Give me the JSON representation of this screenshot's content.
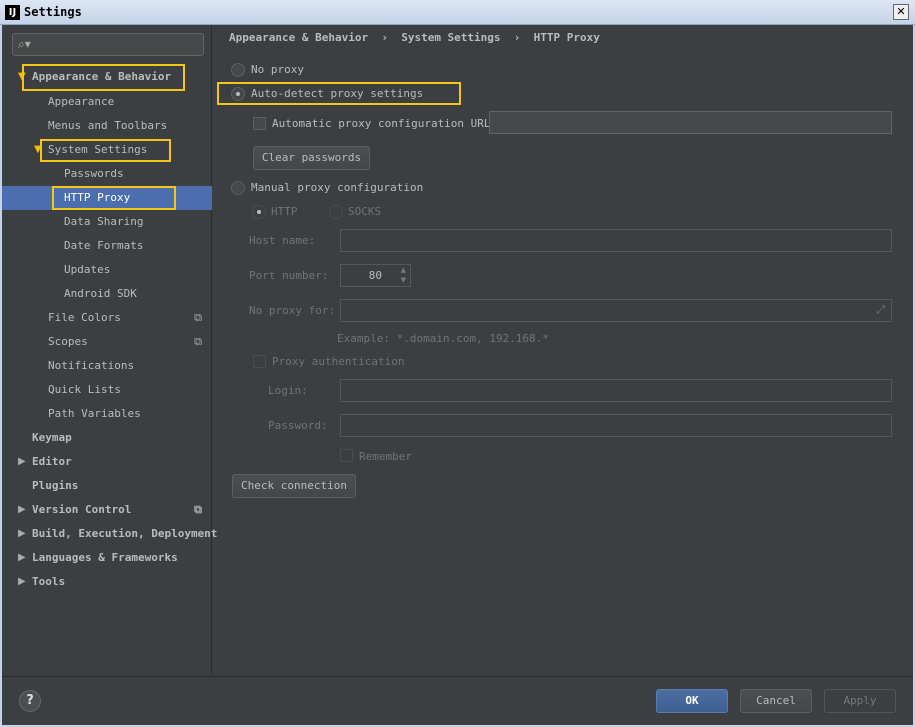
{
  "window": {
    "title": "Settings",
    "app_icon": "IJ",
    "close": "✕"
  },
  "sidebar": {
    "search_placeholder": "",
    "items": [
      {
        "label": "Appearance & Behavior"
      },
      {
        "label": "Appearance"
      },
      {
        "label": "Menus and Toolbars"
      },
      {
        "label": "System Settings"
      },
      {
        "label": "Passwords"
      },
      {
        "label": "HTTP Proxy"
      },
      {
        "label": "Data Sharing"
      },
      {
        "label": "Date Formats"
      },
      {
        "label": "Updates"
      },
      {
        "label": "Android SDK"
      },
      {
        "label": "File Colors"
      },
      {
        "label": "Scopes"
      },
      {
        "label": "Notifications"
      },
      {
        "label": "Quick Lists"
      },
      {
        "label": "Path Variables"
      },
      {
        "label": "Keymap"
      },
      {
        "label": "Editor"
      },
      {
        "label": "Plugins"
      },
      {
        "label": "Version Control"
      },
      {
        "label": "Build, Execution, Deployment"
      },
      {
        "label": "Languages & Frameworks"
      },
      {
        "label": "Tools"
      }
    ]
  },
  "breadcrumb": {
    "part1": "Appearance & Behavior",
    "sep": "›",
    "part2": "System Settings",
    "part3": "HTTP Proxy"
  },
  "proxy": {
    "no_proxy": "No proxy",
    "auto_detect": "Auto-detect proxy settings",
    "auto_config_url": "Automatic proxy configuration URL:",
    "auto_config_url_value": "",
    "clear_passwords": "Clear passwords",
    "manual": "Manual proxy configuration",
    "http": "HTTP",
    "socks": "SOCKS",
    "host_name": "Host name:",
    "host_value": "",
    "port_number": "Port number:",
    "port_value": "80",
    "no_proxy_for": "No proxy for:",
    "no_proxy_value": "",
    "example": "Example: *.domain.com, 192.168.*",
    "proxy_auth": "Proxy authentication",
    "login": "Login:",
    "login_value": "",
    "password": "Password:",
    "password_value": "",
    "remember": "Remember",
    "check_connection": "Check connection"
  },
  "footer": {
    "help": "?",
    "ok": "OK",
    "cancel": "Cancel",
    "apply": "Apply"
  },
  "colors": {
    "accent": "#4b6eaf",
    "highlight": "#f5c518",
    "background": "#3c3f41"
  }
}
